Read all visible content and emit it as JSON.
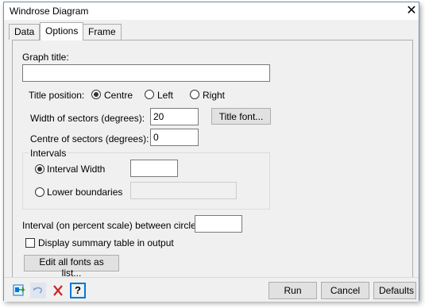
{
  "window": {
    "title": "Windrose Diagram",
    "close_glyph": "✕"
  },
  "tabs": [
    {
      "label": "Data"
    },
    {
      "label": "Options"
    },
    {
      "label": "Frame"
    }
  ],
  "options": {
    "graph_title_label": "Graph title:",
    "graph_title_value": "",
    "title_position_label": "Title position:",
    "title_position_options": [
      "Centre",
      "Left",
      "Right"
    ],
    "title_position_selected": "Centre",
    "width_sectors_label": "Width of sectors (degrees):",
    "width_sectors_value": "20",
    "title_font_button": "Title font...",
    "centre_sectors_label": "Centre of sectors (degrees):",
    "centre_sectors_value": "0",
    "intervals_group_label": "Intervals",
    "interval_width_label": "Interval Width",
    "interval_width_value": "",
    "lower_boundaries_label": "Lower boundaries",
    "lower_boundaries_value": "",
    "interval_selected": "Interval Width",
    "circles_label": "Interval (on percent scale) between circles:",
    "circles_value": "",
    "summary_checkbox_label": "Display summary table in output",
    "summary_checked": false,
    "edit_fonts_button": "Edit all fonts as list..."
  },
  "footer": {
    "icons": [
      "pin-icon",
      "undo-icon",
      "clear-icon",
      "help-icon"
    ],
    "help_glyph": "?",
    "run_button": "Run",
    "cancel_button": "Cancel",
    "defaults_button": "Defaults"
  },
  "colors": {
    "accent_blue": "#0078d7",
    "clear_red": "#c62828",
    "window_border": "#6e8fb5"
  }
}
